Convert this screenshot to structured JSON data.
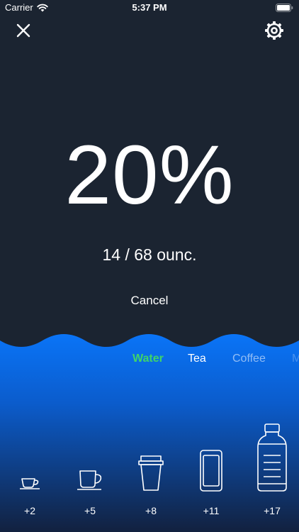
{
  "status_bar": {
    "carrier": "Carrier",
    "time": "5:37 PM"
  },
  "progress": {
    "percent_text": "20%",
    "amount_text": "14 / 68 ounc.",
    "fraction": 0.2
  },
  "cancel_label": "Cancel",
  "drink_types": [
    {
      "label": "Water",
      "selected": true
    },
    {
      "label": "Tea",
      "selected": false
    },
    {
      "label": "Coffee",
      "selected": false
    },
    {
      "label": "M",
      "selected": false
    }
  ],
  "cups": [
    {
      "label": "+2",
      "icon": "espresso-cup-icon"
    },
    {
      "label": "+5",
      "icon": "coffee-mug-icon"
    },
    {
      "label": "+8",
      "icon": "takeaway-cup-icon"
    },
    {
      "label": "+11",
      "icon": "can-icon"
    },
    {
      "label": "+17",
      "icon": "bottle-icon"
    }
  ],
  "colors": {
    "background": "#1b2431",
    "water_top": "#0a74f7",
    "water_bottom": "#12213f",
    "selected_tab": "#3fd46a"
  }
}
